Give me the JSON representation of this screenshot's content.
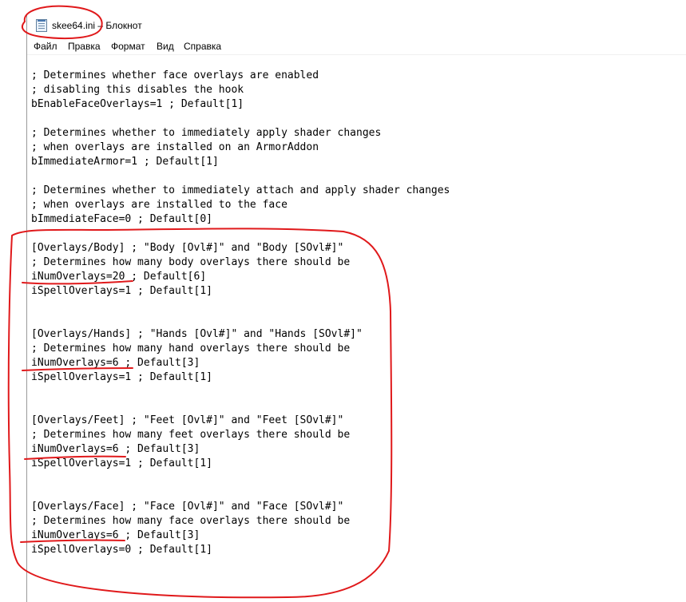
{
  "window": {
    "title": "skee64.ini – Блокнот",
    "app_icon": "notepad-icon"
  },
  "menu": {
    "items": [
      {
        "label": "Файл"
      },
      {
        "label": "Правка"
      },
      {
        "label": "Формат"
      },
      {
        "label": "Вид"
      },
      {
        "label": "Справка"
      }
    ]
  },
  "document": {
    "text": "; Determines whether face overlays are enabled\n; disabling this disables the hook\nbEnableFaceOverlays=1 ; Default[1]\n\n; Determines whether to immediately apply shader changes\n; when overlays are installed on an ArmorAddon\nbImmediateArmor=1 ; Default[1]\n\n; Determines whether to immediately attach and apply shader changes\n; when overlays are installed to the face\nbImmediateFace=0 ; Default[0]\n\n[Overlays/Body] ; \"Body [Ovl#]\" and \"Body [SOvl#]\"\n; Determines how many body overlays there should be\niNumOverlays=20 ; Default[6]\niSpellOverlays=1 ; Default[1]\n\n\n[Overlays/Hands] ; \"Hands [Ovl#]\" and \"Hands [SOvl#]\"\n; Determines how many hand overlays there should be\niNumOverlays=6 ; Default[3]\niSpellOverlays=1 ; Default[1]\n\n\n[Overlays/Feet] ; \"Feet [Ovl#]\" and \"Feet [SOvl#]\"\n; Determines how many feet overlays there should be\niNumOverlays=6 ; Default[3]\niSpellOverlays=1 ; Default[1]\n\n\n[Overlays/Face] ; \"Face [Ovl#]\" and \"Face [SOvl#]\"\n; Determines how many face overlays there should be\niNumOverlays=6 ; Default[3]\niSpellOverlays=0 ; Default[1]"
  },
  "colors": {
    "annotation": "#e0191b",
    "window_border": "#9a9a9a",
    "text": "#000000"
  }
}
